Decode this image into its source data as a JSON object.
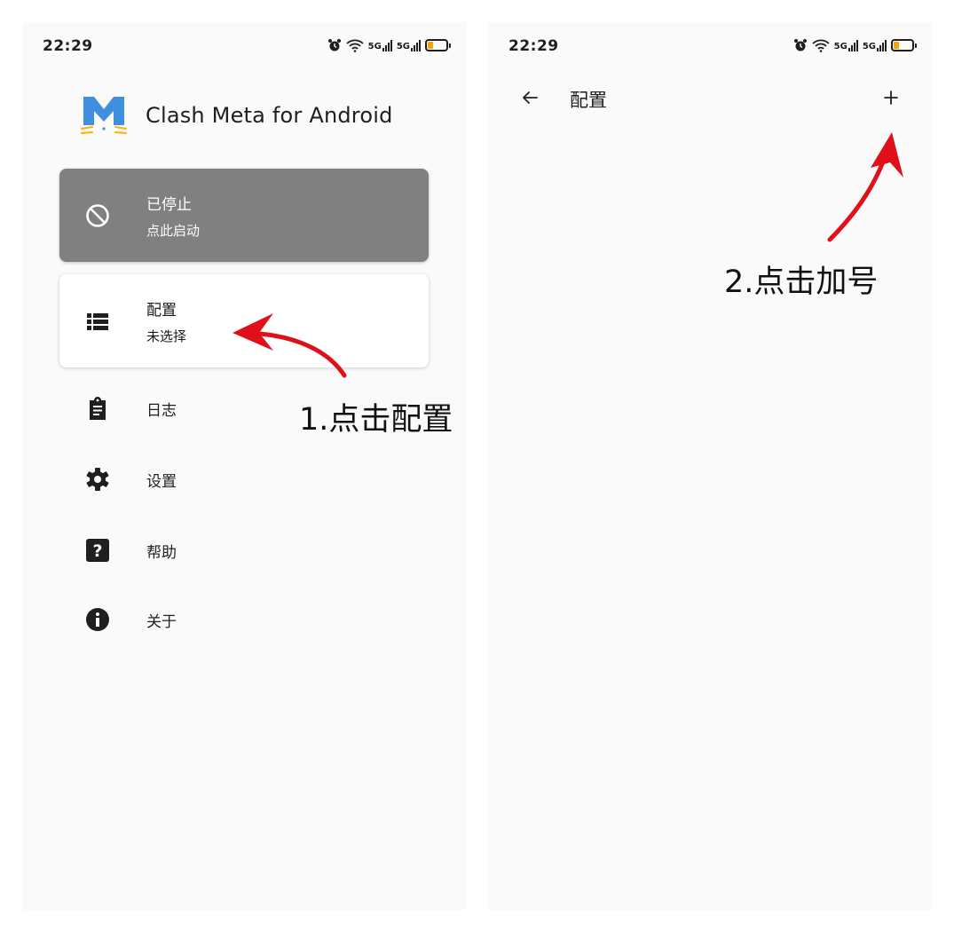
{
  "left_screen": {
    "status_bar": {
      "time": "22:29",
      "net_1": "5G",
      "net_2": "5G"
    },
    "app_title": "Clash Meta for Android",
    "status_card": {
      "title": "已停止",
      "subtitle": "点此启动"
    },
    "profile_card": {
      "title": "配置",
      "subtitle": "未选择"
    },
    "menu": [
      {
        "label": "日志",
        "icon": "clipboard-icon"
      },
      {
        "label": "设置",
        "icon": "gear-icon"
      },
      {
        "label": "帮助",
        "icon": "help-icon"
      },
      {
        "label": "关于",
        "icon": "info-icon"
      }
    ]
  },
  "right_screen": {
    "status_bar": {
      "time": "22:29",
      "net_1": "5G",
      "net_2": "5G"
    },
    "toolbar": {
      "title": "配置",
      "back_icon": "arrow-left-icon",
      "add_label": "+"
    }
  },
  "annotations": {
    "step1": "1.点击配置",
    "step2": "2.点击加号"
  },
  "colors": {
    "status_card_bg": "#808080",
    "logo_blue": "#3f8fe0",
    "logo_whisker": "#f6b400",
    "battery_fill": "#f6a400",
    "annotation_arrow": "#e0101a"
  }
}
